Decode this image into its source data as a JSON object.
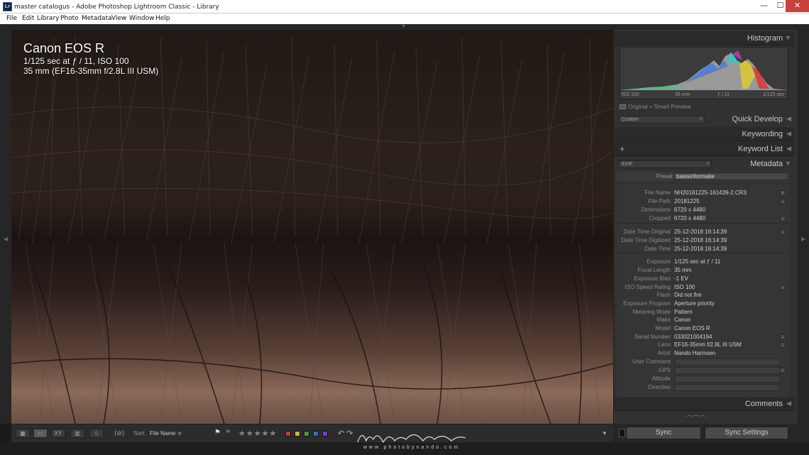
{
  "window": {
    "title": "master catalogus - Adobe Photoshop Lightroom Classic - Library",
    "app_icon": "Lr",
    "min": "—",
    "max": "☐",
    "close": "✕"
  },
  "menu": [
    "File",
    "Edit",
    "Library",
    "Photo",
    "Metadata",
    "View",
    "Window",
    "Help"
  ],
  "overlay": {
    "camera": "Canon EOS R",
    "exposure": "1/125 sec at ƒ / 11, ISO 100",
    "lens": "35 mm (EF16-35mm f/2.8L III USM)"
  },
  "histogram": {
    "header": "Histogram",
    "iso": "ISO 100",
    "focal": "35 mm",
    "aperture": "ƒ / 11",
    "shutter": "1/125 sec",
    "preview": "Original + Smart Preview"
  },
  "quick_develop": {
    "header": "Quick Develop",
    "preset_select": "Custom"
  },
  "keywording": {
    "header": "Keywording"
  },
  "keyword_list": {
    "header": "Keyword List",
    "add": "+"
  },
  "metadata": {
    "header": "Metadata",
    "view_select": "EXIF",
    "preset_label": "Preset",
    "preset_value": "basisinformatie",
    "groups": [
      [
        {
          "key": "File Name",
          "value": "NH20181225-161439-2.CR3",
          "button": "≡"
        },
        {
          "key": "File Path",
          "value": "20181225",
          "button": "→"
        },
        {
          "key": "Dimensions",
          "value": "6720 x 4480"
        },
        {
          "key": "Cropped",
          "value": "6720 x 4480",
          "button": "→"
        }
      ],
      [
        {
          "key": "Date Time Original",
          "value": "25-12-2018 16:14:39",
          "button": "→"
        },
        {
          "key": "Date Time Digitized",
          "value": "25-12-2018 16:14:39"
        },
        {
          "key": "Date Time",
          "value": "25-12-2018 16:14:39"
        }
      ],
      [
        {
          "key": "Exposure",
          "value": "1/125 sec at ƒ / 11"
        },
        {
          "key": "Focal Length",
          "value": "35 mm"
        },
        {
          "key": "Exposure Bias",
          "value": "-1 EV"
        },
        {
          "key": "ISO Speed Rating",
          "value": "ISO 100",
          "button": "→"
        },
        {
          "key": "Flash",
          "value": "Did not fire"
        },
        {
          "key": "Exposure Program",
          "value": "Aperture priority"
        },
        {
          "key": "Metering Mode",
          "value": "Pattern"
        },
        {
          "key": "Make",
          "value": "Canon"
        },
        {
          "key": "Model",
          "value": "Canon EOS R"
        },
        {
          "key": "Serial Number",
          "value": "033021004194",
          "button": "→"
        },
        {
          "key": "Lens",
          "value": "EF16-35mm f/2.8L III USM",
          "button": "→"
        },
        {
          "key": "Artist",
          "value": "Nando Harmsen"
        },
        {
          "key": "User Comment",
          "value": ""
        },
        {
          "key": "GPS",
          "value": "",
          "button": "→"
        },
        {
          "key": "Altitude",
          "value": ""
        },
        {
          "key": "Direction",
          "value": ""
        }
      ]
    ]
  },
  "comments": {
    "header": "Comments"
  },
  "sync": {
    "sync": "Sync",
    "sync_settings": "Sync Settings"
  },
  "toolbar": {
    "sort_label": "Sort:",
    "sort_value": "File Name ≑",
    "stars": "★★★★★",
    "color_labels": [
      "#c43a3a",
      "#c8b53a",
      "#4a9a3a",
      "#3a6ac4",
      "#7a3ac4"
    ],
    "view_icons": [
      "grid-view",
      "loupe-view",
      "compare-view",
      "survey-view",
      "people-view"
    ],
    "view_glyphs": [
      "▦",
      "▭",
      "XY",
      "▥",
      "☺"
    ],
    "painter": "⟨⊘⟩",
    "rotate": "↶ ↷",
    "dropdown": "▼"
  },
  "watermark": {
    "signature": "Nando Harmsen",
    "url": "www.photobynando.com"
  },
  "colors": {
    "panel_bg": "#313131",
    "header_bg": "#2a2a2a",
    "close_red": "#c8413a"
  }
}
